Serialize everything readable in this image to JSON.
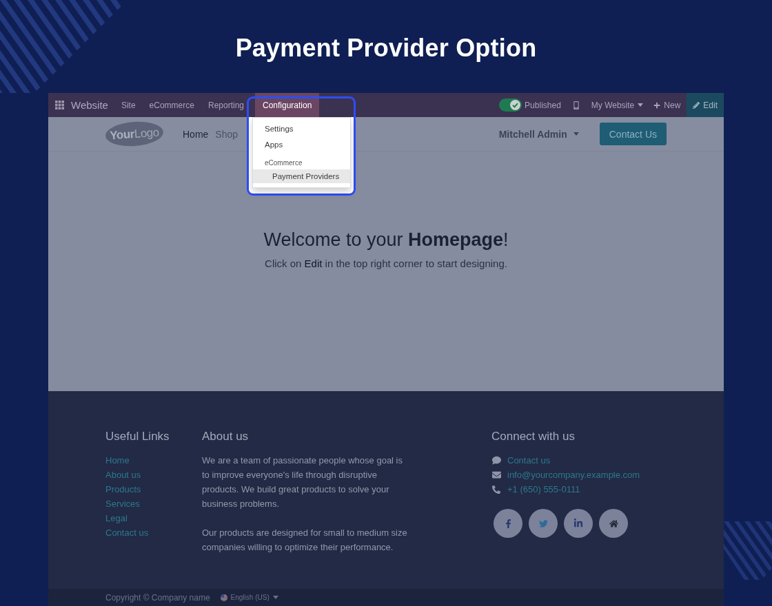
{
  "title": "Payment Provider Option",
  "topbar": {
    "app_name": "Website",
    "menus": [
      {
        "label": "Site",
        "selected": false
      },
      {
        "label": "eCommerce",
        "selected": false
      },
      {
        "label": "Reporting",
        "selected": false
      },
      {
        "label": "Configuration",
        "selected": true
      }
    ],
    "published": {
      "label": "Published",
      "on": true
    },
    "website_switcher": "My Website",
    "new_button": "New",
    "edit_button": "Edit"
  },
  "configuration_dropdown": {
    "items": [
      {
        "kind": "item",
        "label": "Settings",
        "selected": false
      },
      {
        "kind": "item",
        "label": "Apps",
        "selected": false
      },
      {
        "kind": "section",
        "label": "eCommerce",
        "children": [
          {
            "label": "Payment Providers",
            "selected": true
          }
        ]
      }
    ]
  },
  "header": {
    "logo": "**Your**Logo",
    "nav": [
      {
        "label": "Home",
        "selected": true
      },
      {
        "label": "Shop",
        "selected": false
      }
    ],
    "user": "Mitchell Admin",
    "cta": "Contact Us"
  },
  "hero": {
    "heading": "Welcome to your **Homepage**!",
    "subtitle": "Click on **Edit** in the top right corner to start designing."
  },
  "footer": {
    "useful_links": {
      "heading": "Useful Links",
      "links": [
        "Home",
        "About us",
        "Products",
        "Services",
        "Legal",
        "Contact us"
      ]
    },
    "about": {
      "heading": "About us",
      "paragraphs": [
        "We are a team of passionate people whose goal is to improve everyone's life through disruptive products. We build great products to solve your business problems.",
        "Our products are designed for small to medium size companies willing to optimize their performance."
      ]
    },
    "connect": {
      "heading": "Connect with us",
      "contacts": [
        {
          "kind": "chat",
          "label": "Contact us"
        },
        {
          "kind": "email",
          "label": "info@yourcompany.example.com"
        },
        {
          "kind": "phone",
          "label": "+1 (650) 555-0111"
        }
      ],
      "social": [
        {
          "kind": "facebook"
        },
        {
          "kind": "twitter"
        },
        {
          "kind": "linkedin"
        },
        {
          "kind": "home"
        }
      ]
    }
  },
  "copyright": {
    "text": "Copyright © Company name",
    "language": "English (US)"
  }
}
